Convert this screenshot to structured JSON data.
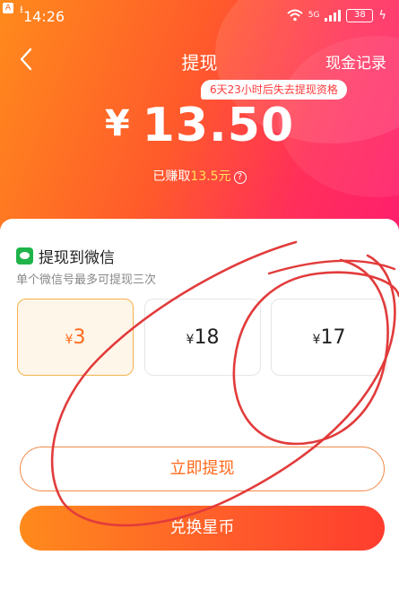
{
  "status_bar": {
    "time": "14:26",
    "network": "5G",
    "battery": "38"
  },
  "header": {
    "title": "提现",
    "records_link": "现金记录",
    "tip": "6天23小时后失去提现资格"
  },
  "balance": {
    "currency": "¥",
    "amount": "13.50",
    "earned_prefix": "已赚取",
    "earned_value": "13.5元"
  },
  "withdraw": {
    "title": "提现到微信",
    "subtitle": "单个微信号最多可提现三次",
    "options": [
      {
        "currency": "¥",
        "value": "3",
        "selected": true
      },
      {
        "currency": "¥",
        "value": "18",
        "selected": false
      },
      {
        "currency": "¥",
        "value": "17",
        "selected": false
      }
    ]
  },
  "buttons": {
    "withdraw_now": "立即提现",
    "exchange_coins": "兑换星币"
  },
  "colors": {
    "accent": "#ff5a2b",
    "highlight": "#ffe15a",
    "wechat": "#1fb34a",
    "scribble": "#e23b3b"
  }
}
